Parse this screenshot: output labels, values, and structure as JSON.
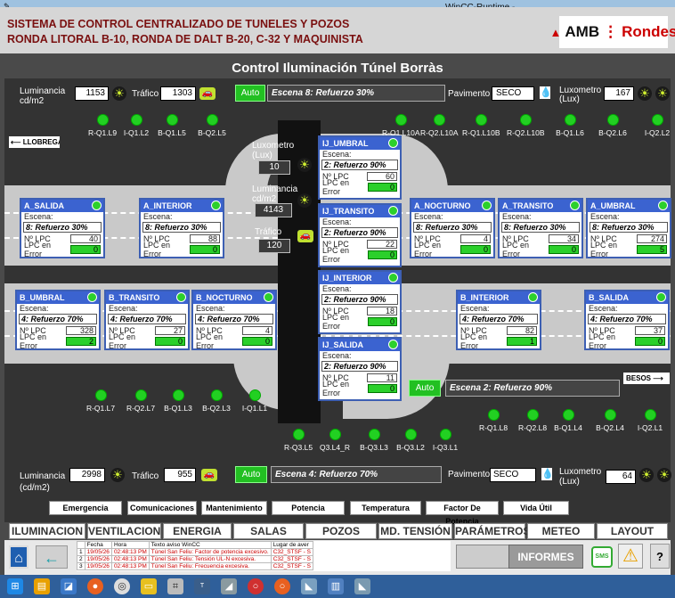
{
  "window_title": "WinCC-Runtime -",
  "header": {
    "line1": "SISTEMA DE CONTROL CENTRALIZADO DE TUNELES Y POZOS",
    "line2": "RONDA LITORAL B-10, RONDA DE DALT B-20, C-32 Y MAQUINISTA",
    "logo_amb": "AMB",
    "logo_sep": "⋮",
    "logo_rondes": "Rondes"
  },
  "page_title": "Control Iluminación Túnel Borràs",
  "top": {
    "lum_label": "Luminancia",
    "lum_unit": "cd/m2",
    "lum_value": "1153",
    "trafico_label": "Tráfico",
    "trafico_value": "1303",
    "auto": "Auto",
    "scene": "Escena 8: Refuerzo 30%",
    "pav_label": "Pavimento",
    "pav_value": "SECO",
    "lux_label": "Luxometro",
    "lux_unit": "(Lux)",
    "lux_value": "167"
  },
  "bottom": {
    "lum_label": "Luminancia",
    "lum_unit": "(cd/m2)",
    "lum_value": "2998",
    "trafico_label": "Tráfico",
    "trafico_value": "955",
    "auto": "Auto",
    "scene": "Escena 4: Refuerzo 70%",
    "pav_label": "Pavimento",
    "pav_value": "SECO",
    "lux_label": "Luxometro",
    "lux_unit": "(Lux)",
    "lux_value": "64"
  },
  "mid": {
    "luxometro": "Luxometro",
    "lux_unit": "(Lux)",
    "lux_value": "10",
    "luminancia": "Luminancia",
    "lum_unit": "cd/m2",
    "lum_value": "4143",
    "trafico": "Tráfico",
    "trafico_value": "120",
    "auto": "Auto",
    "scene": "Escena 2: Refuerzo 90%"
  },
  "dir_left": "LLOBREGAT",
  "dir_right": "BESOS",
  "ctl_top_left": [
    "R-Q1.L9",
    "I-Q1.L2",
    "B-Q1.L5",
    "B-Q2.L5"
  ],
  "ctl_top_right": [
    "R-Q1.L10A",
    "R-Q2.L10A",
    "R-Q1.L10B",
    "R-Q2.L10B",
    "B-Q1.L6",
    "B-Q2.L6",
    "I-Q2.L2"
  ],
  "ctl_low_left": [
    "R-Q1.L7",
    "R-Q2.L7",
    "B-Q1.L3",
    "B-Q2.L3",
    "I-Q1.L1"
  ],
  "ctl_low_right": [
    "R-Q1.L8",
    "R-Q2.L8",
    "B-Q1.L4",
    "B-Q2.L4",
    "I-Q2.L1"
  ],
  "ctl_bottom": [
    "R-Q3.L5",
    "Q3.L4_R",
    "B-Q3.L3",
    "B-Q3.L2",
    "I-Q3.L1"
  ],
  "panel_labels": {
    "escena": "Escena:",
    "nlpc": "Nº LPC",
    "err": "LPC en Error"
  },
  "panels": [
    {
      "name": "A_SALIDA",
      "scene": "8: Refuerzo 30%",
      "lpc": "40",
      "err": "0"
    },
    {
      "name": "A_INTERIOR",
      "scene": "8: Refuerzo 30%",
      "lpc": "88",
      "err": "0"
    },
    {
      "name": "A_NOCTURNO",
      "scene": "8: Refuerzo 30%",
      "lpc": "4",
      "err": "0"
    },
    {
      "name": "A_TRANSITO",
      "scene": "8: Refuerzo 30%",
      "lpc": "34",
      "err": "0"
    },
    {
      "name": "A_UMBRAL",
      "scene": "8: Refuerzo 30%",
      "lpc": "274",
      "err": "5"
    },
    {
      "name": "B_UMBRAL",
      "scene": "4: Refuerzo 70%",
      "lpc": "328",
      "err": "2"
    },
    {
      "name": "B_TRANSITO",
      "scene": "4: Refuerzo 70%",
      "lpc": "27",
      "err": "0"
    },
    {
      "name": "B_NOCTURNO",
      "scene": "4: Refuerzo 70%",
      "lpc": "4",
      "err": "0"
    },
    {
      "name": "B_INTERIOR",
      "scene": "4: Refuerzo 70%",
      "lpc": "82",
      "err": "1"
    },
    {
      "name": "B_SALIDA",
      "scene": "4: Refuerzo 70%",
      "lpc": "37",
      "err": "0"
    },
    {
      "name": "IJ_UMBRAL",
      "scene": "2: Refuerzo 90%",
      "lpc": "60",
      "err": "0"
    },
    {
      "name": "IJ_TRANSITO",
      "scene": "2: Refuerzo 90%",
      "lpc": "22",
      "err": "0"
    },
    {
      "name": "IJ_INTERIOR",
      "scene": "2: Refuerzo 90%",
      "lpc": "18",
      "err": "0"
    },
    {
      "name": "IJ_SALIDA",
      "scene": "2: Refuerzo 90%",
      "lpc": "11",
      "err": "0"
    }
  ],
  "bars": [
    "Emergencia",
    "Comunicaciones",
    "Mantenimiento",
    "Potencia",
    "Temperatura",
    "Factor De Potencia",
    "Vida Útil"
  ],
  "tabs": [
    "ILUMINACION",
    "VENTILACION",
    "ENERGIA",
    "SALAS",
    "POZOS",
    "MD. TENSIÓN",
    "PARÁMETROS",
    "METEO",
    "LAYOUT"
  ],
  "alarms": {
    "headers": [
      "",
      "Fecha",
      "Hora",
      "Texto aviso WinCC",
      "Lugar de aver"
    ],
    "rows": [
      [
        "1",
        "19/05/26",
        "02:48:13 PM",
        "Túnel San Feliu:   Factor de potencia excesivo.",
        "C32_STSF - S"
      ],
      [
        "2",
        "19/05/26",
        "02:48:13 PM",
        "Túnel San Feliu:   Tensión UL-N excesiva.",
        "C32_STSF - S"
      ],
      [
        "3",
        "19/05/26",
        "02:48:13 PM",
        "Túnel San Feliu:   Frecuencia excesiva.",
        "C32_STSF - S"
      ]
    ]
  },
  "informes": "INFORMES",
  "sms": "SMS",
  "help": "?",
  "colors": {
    "panel_head": "#3b63d0",
    "led_green": "#22d022",
    "header_text": "#7a1010"
  }
}
